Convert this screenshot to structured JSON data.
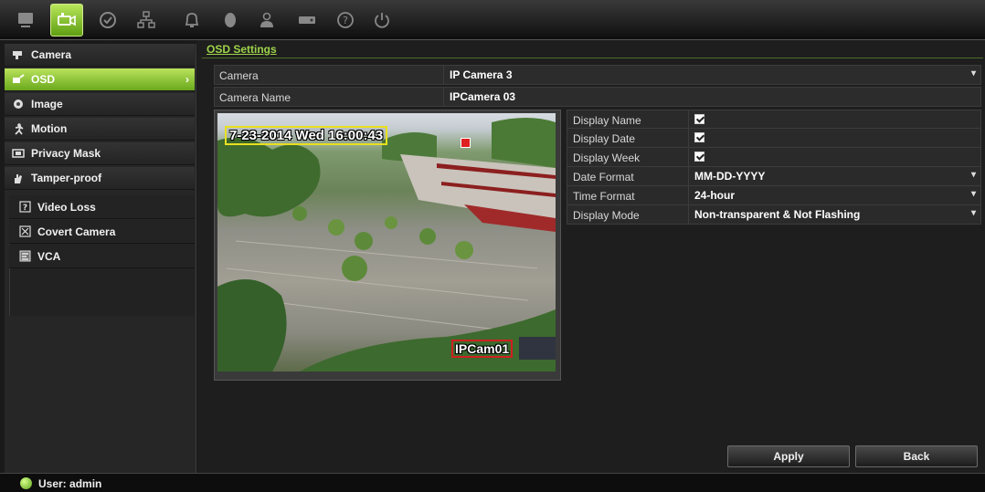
{
  "toolbar": {
    "items": [
      {
        "icon": "monitor-icon",
        "active": false
      },
      {
        "icon": "camera-icon",
        "active": true
      },
      {
        "icon": "playback-icon",
        "active": false
      },
      {
        "icon": "network-icon",
        "active": false
      },
      {
        "icon": "alarm-icon",
        "active": false
      },
      {
        "icon": "device-icon",
        "active": false
      },
      {
        "icon": "user-icon",
        "active": false
      },
      {
        "icon": "hdd-icon",
        "active": false
      },
      {
        "icon": "help-icon",
        "active": false
      },
      {
        "icon": "power-icon",
        "active": false
      }
    ]
  },
  "sidebar": {
    "items": [
      {
        "label": "Camera",
        "icon": "camera-small-icon"
      },
      {
        "label": "OSD",
        "icon": "osd-icon",
        "active": true,
        "arrow": "›"
      },
      {
        "label": "Image",
        "icon": "image-icon"
      },
      {
        "label": "Motion",
        "icon": "motion-icon"
      },
      {
        "label": "Privacy Mask",
        "icon": "privacy-mask-icon"
      },
      {
        "label": "Tamper-proof",
        "icon": "tamper-icon"
      }
    ],
    "subitems": [
      {
        "label": "Video Loss",
        "icon": "video-loss-icon"
      },
      {
        "label": "Covert Camera",
        "icon": "covert-camera-icon"
      },
      {
        "label": "VCA",
        "icon": "vca-icon"
      }
    ]
  },
  "main": {
    "title": "OSD Settings",
    "camera": {
      "label": "Camera",
      "value": "IP Camera 3"
    },
    "camera_name": {
      "label": "Camera Name",
      "value": "IPCamera 03"
    },
    "preview": {
      "osd_time": "7-23-2014 Wed 16:00:43",
      "osd_name": "IPCam01"
    },
    "settings": [
      {
        "label": "Display Name",
        "type": "checkbox",
        "checked": true
      },
      {
        "label": "Display Date",
        "type": "checkbox",
        "checked": true
      },
      {
        "label": "Display Week",
        "type": "checkbox",
        "checked": true
      },
      {
        "label": "Date Format",
        "type": "select",
        "value": "MM-DD-YYYY"
      },
      {
        "label": "Time Format",
        "type": "select",
        "value": "24-hour"
      },
      {
        "label": "Display Mode",
        "type": "select",
        "value": "Non-transparent & Not Flashing"
      }
    ],
    "apply_label": "Apply",
    "back_label": "Back"
  },
  "status": {
    "user_text": "User: admin"
  },
  "colors": {
    "accent": "#8cc63f",
    "osd_date_border": "#e8e020",
    "osd_name_border": "#d02020"
  }
}
